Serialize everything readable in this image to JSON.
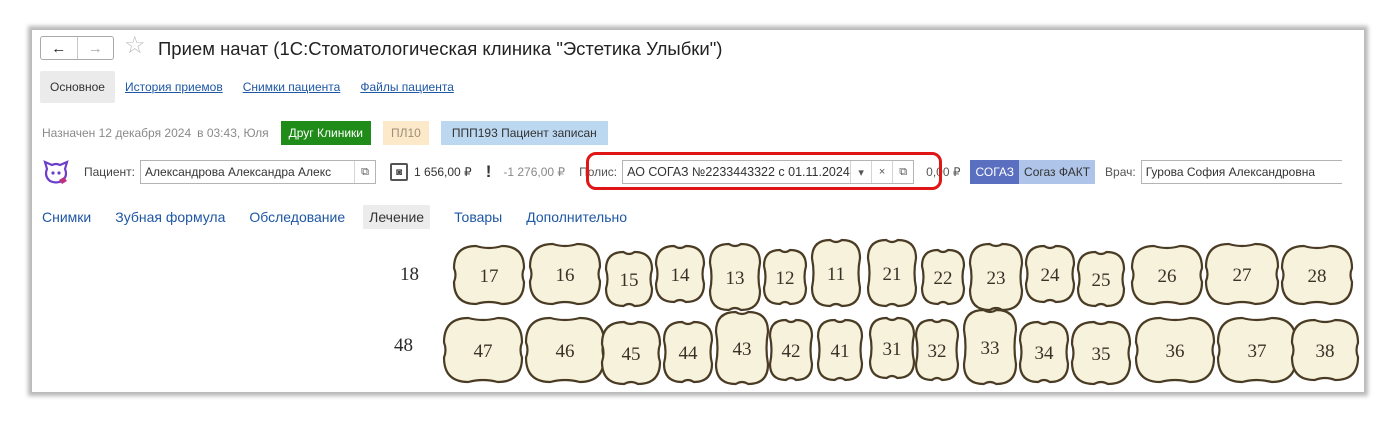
{
  "window": {
    "title": "Прием начат (1С:Стоматологическая клиника \"Эстетика Улыбки\")",
    "nav_back": "←",
    "nav_forward": "→",
    "favorite_icon": "star-icon"
  },
  "top_tabs": {
    "active": "Основное",
    "links": [
      "История приемов",
      "Снимки пациента",
      "Файлы пациента"
    ]
  },
  "status": {
    "assigned_text": "Назначен 12 декабря 2024",
    "time_text": "в 03:43, Юля",
    "badges": [
      "Друг Клиники",
      "ПЛ10",
      "ППП193  Пациент записан"
    ],
    "colors": {
      "friend": "#1f8b19",
      "pl": "#fbe9c9",
      "ppp": "#bcd7f0"
    }
  },
  "patient_row": {
    "patient_label": "Пациент:",
    "patient_value": "Александрова Александра Алекс",
    "balance": "1 656,00 ₽",
    "debt_icon": "!",
    "debt": "-1 276,00 ₽",
    "policy_label": "Полис:",
    "policy_value": "АО СОГАЗ №2233443322 с 01.11.2024",
    "policy_amount": "0,00 ₽",
    "insurer_badge": "СОГАЗ",
    "insurer_fact": "Согаз ФАКТ",
    "doctor_label": "Врач:",
    "doctor_value": "Гурова София Александровна",
    "colors": {
      "sogaz": "#5a6fc0",
      "sogaz_fact": "#aec4e8",
      "highlight": "#e01616"
    }
  },
  "sections": {
    "items": [
      "Снимки",
      "Зубная формула",
      "Обследование",
      "Лечение",
      "Товары",
      "Дополнительно"
    ],
    "active": "Лечение"
  },
  "dental_chart": {
    "upper_row_label": "18",
    "lower_row_label": "48",
    "upper_teeth": [
      "17",
      "16",
      "15",
      "14",
      "13",
      "12",
      "11",
      "21",
      "22",
      "23",
      "24",
      "25",
      "26",
      "27",
      "28"
    ],
    "lower_teeth": [
      "47",
      "46",
      "45",
      "44",
      "43",
      "42",
      "41",
      "31",
      "32",
      "33",
      "34",
      "35",
      "36",
      "37",
      "38"
    ],
    "tooth_fill": "#f7f2dc",
    "tooth_stroke": "#4a3c24"
  }
}
